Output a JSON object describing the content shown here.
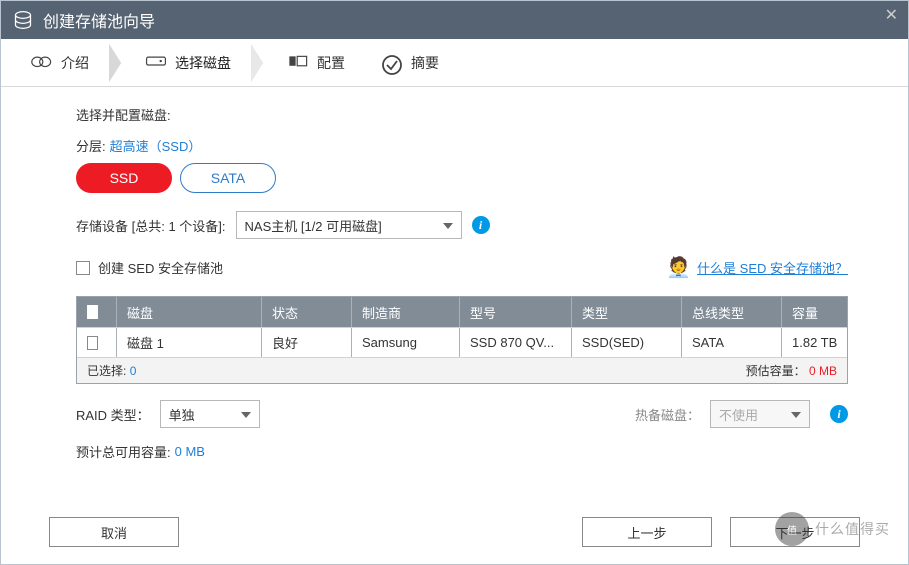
{
  "window": {
    "title": "创建存储池向导"
  },
  "steps": {
    "intro": "介绍",
    "select_disk": "选择磁盘",
    "configure": "配置",
    "summary": "摘要"
  },
  "content": {
    "select_configure_disk": "选择并配置磁盘:",
    "tier_label": "分层:",
    "tier_value": "超高速（SSD）",
    "tab_ssd": "SSD",
    "tab_sata": "SATA",
    "device_label": "存储设备 [总共: 1 个设备]:",
    "device_selected": "NAS主机 [1/2 可用磁盘]",
    "sed_checkbox_label": "创建 SED 安全存储池",
    "sed_help_link": "什么是 SED 安全存储池？",
    "table": {
      "headers": {
        "disk": "磁盘",
        "status": "状态",
        "vendor": "制造商",
        "model": "型号",
        "type": "类型",
        "bus": "总线类型",
        "capacity": "容量"
      },
      "rows": [
        {
          "disk": "磁盘 1",
          "status": "良好",
          "vendor": "Samsung",
          "model": "SSD 870 QV...",
          "type": "SSD(SED)",
          "bus": "SATA",
          "capacity": "1.82 TB"
        }
      ],
      "footer": {
        "selected_label": "已选择:",
        "selected_value": "0",
        "estimated_label": "预估容量：",
        "estimated_value": "0 MB"
      }
    },
    "raid_label": "RAID 类型：",
    "raid_value": "单独",
    "hotspare_label": "热备磁盘：",
    "hotspare_value": "不使用",
    "total_label": "预计总可用容量:",
    "total_value": "0 MB"
  },
  "buttons": {
    "cancel": "取消",
    "prev": "上一步",
    "next": "下一步"
  },
  "watermark": {
    "text": "什么值得买"
  }
}
